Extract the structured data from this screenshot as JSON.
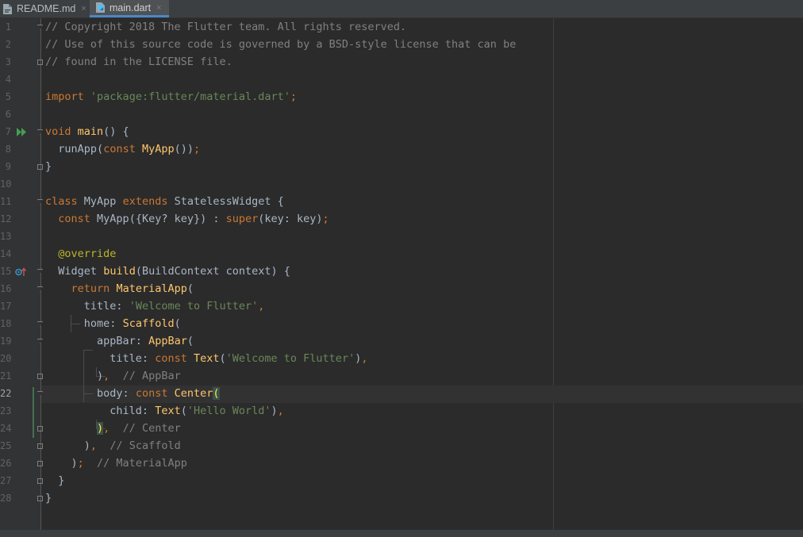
{
  "tabs": [
    {
      "label": "README.md",
      "close": "×",
      "active": false
    },
    {
      "label": "main.dart",
      "close": "×",
      "active": true
    }
  ],
  "editor": {
    "line_numbers": [
      "1",
      "2",
      "3",
      "4",
      "5",
      "6",
      "7",
      "8",
      "9",
      "10",
      "11",
      "12",
      "13",
      "14",
      "15",
      "16",
      "17",
      "18",
      "19",
      "20",
      "21",
      "22",
      "23",
      "24",
      "25",
      "26",
      "27",
      "28"
    ],
    "current_line": "22",
    "code": {
      "l1": "// Copyright 2018 The Flutter team. All rights reserved.",
      "l2": "// Use of this source code is governed by a BSD-style license that can be",
      "l3": "// found in the LICENSE file.",
      "l5_kw": "import",
      "l5_str": "'package:flutter/material.dart'",
      "l7_kw": "void",
      "l7_fn": "main",
      "l8_fn": "runApp",
      "l8_kw": "const",
      "l8_cls": "MyApp",
      "l11_kw1": "class",
      "l11_cls": "MyApp",
      "l11_kw2": "extends",
      "l11_sup": "StatelessWidget",
      "l12_kw": "const",
      "l12_cls": "MyApp",
      "l12_args": "({Key? key})",
      "l12_super": "super",
      "l12_rest": "(key: key)",
      "l14_ann": "@override",
      "l15_type": "Widget",
      "l15_fn": "build",
      "l15_args": "(BuildContext context) {",
      "l16_kw": "return",
      "l16_cls": "MaterialApp",
      "l17_name": "title:",
      "l17_str": "'Welcome to Flutter'",
      "l18_name": "home:",
      "l18_cls": "Scaffold",
      "l19_name": "appBar:",
      "l19_cls": "AppBar",
      "l20_name": "title:",
      "l20_kw": "const",
      "l20_cls": "Text",
      "l20_str": "'Welcome to Flutter'",
      "l21_cmt": "// AppBar",
      "l22_name": "body:",
      "l22_kw": "const",
      "l22_cls": "Center",
      "l23_name": "child:",
      "l23_cls": "Text",
      "l23_str": "'Hello World'",
      "l24_cmt": "// Center",
      "l25_cmt": "// Scaffold",
      "l26_cmt": "// MaterialApp"
    }
  },
  "icons": [
    "markdown-file-icon",
    "dart-file-icon",
    "run-icon",
    "override-icon",
    "fold-icon"
  ]
}
